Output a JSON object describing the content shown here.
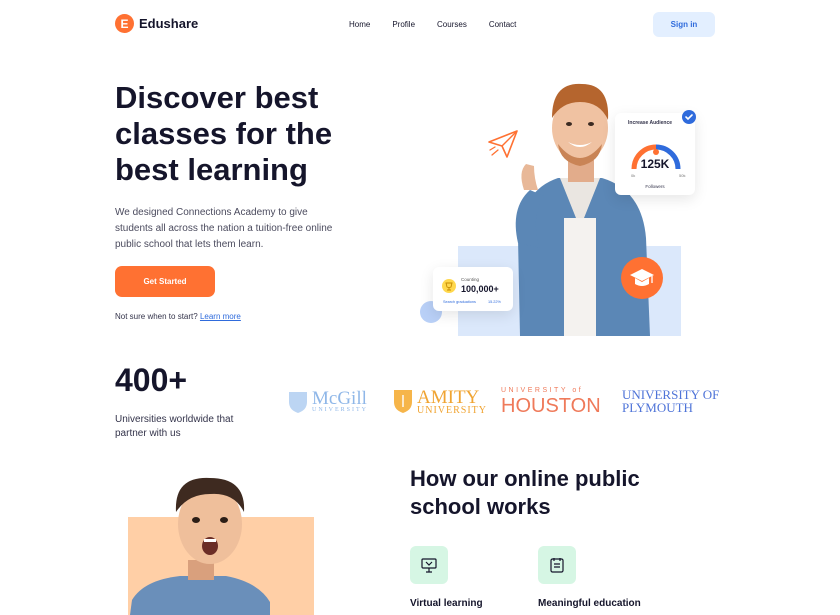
{
  "header": {
    "logo_letter": "E",
    "brand": "Edushare",
    "nav": [
      "Home",
      "Profile",
      "Courses",
      "Contact"
    ],
    "signin_label": "Sign in"
  },
  "hero": {
    "title": "Discover best classes for the best learning",
    "description": "We designed Connections Academy to give students all across the nation a tuition-free online public school that lets them learn.",
    "cta_label": "Get Started",
    "hint_text": "Not sure when to start?",
    "hint_link": "Learn more"
  },
  "audience_card": {
    "tag": "Increase Audience",
    "value": "125K",
    "label": "Followers",
    "min": "0k",
    "max": "50k"
  },
  "counting_card": {
    "tag": "Counting",
    "value": "100,000+",
    "label": "Search graduations",
    "percent": "15.22%"
  },
  "stats": {
    "value": "400+",
    "description": "Universities worldwide that partner with us"
  },
  "universities": {
    "mcgill": {
      "name": "McGill",
      "sub": "UNIVERSITY"
    },
    "amity": {
      "name": "AMITY",
      "sub": "UNIVERSITY"
    },
    "houston": {
      "sub": "UNIVERSITY of",
      "name": "HOUSTON"
    },
    "plymouth": {
      "line1": "UNIVERSITY OF",
      "line2": "PLYMOUTH"
    }
  },
  "how": {
    "title": "How our online public school works",
    "features": [
      {
        "label": "Virtual learning",
        "icon": "presentation-board-icon"
      },
      {
        "label": "Meaningful education",
        "icon": "notepad-icon"
      }
    ]
  },
  "colors": {
    "accent": "#ff7132",
    "primary_blue": "#2f6bdc",
    "text": "#15152b",
    "mint": "#d6f6e4"
  }
}
